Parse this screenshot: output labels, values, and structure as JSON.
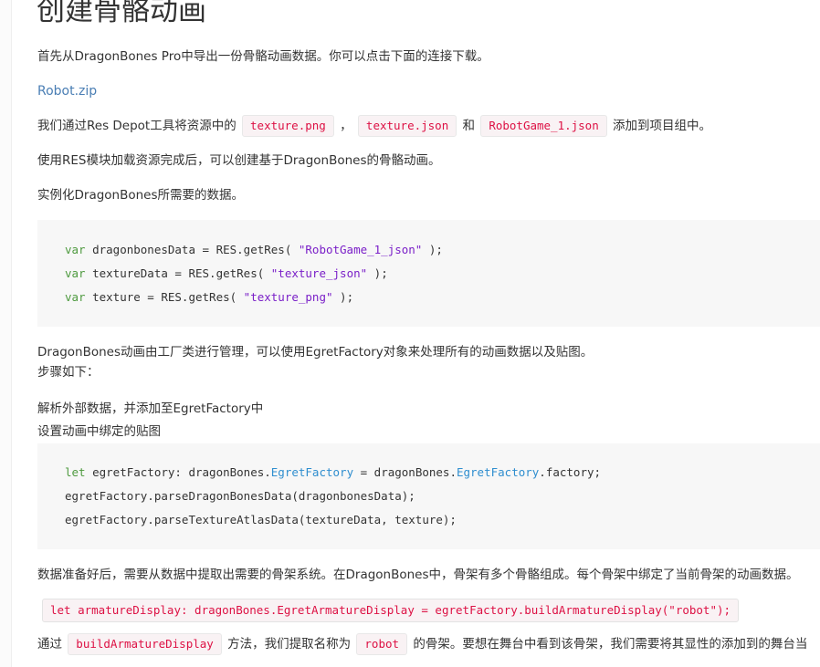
{
  "heading": "创建骨骼动画",
  "p1": "首先从DragonBones Pro中导出一份骨骼动画数据。你可以点击下面的连接下载。",
  "download_link": "Robot.zip",
  "p2": {
    "prefix": "我们通过Res Depot工具将资源中的",
    "file1": "texture.png",
    "sep1": "，",
    "file2": "texture.json",
    "and": "和",
    "file3": "RobotGame_1.json",
    "suffix": "添加到项目组中。"
  },
  "p3": "使用RES模块加载资源完成后，可以创建基于DragonBones的骨骼动画。",
  "p4": "实例化DragonBones所需要的数据。",
  "code1": [
    {
      "kw": "var",
      "pre": " dragonbonesData = RES.getRes( ",
      "str": "\"RobotGame_1_json\"",
      "post": " );"
    },
    {
      "kw": "var",
      "pre": " textureData = RES.getRes( ",
      "str": "\"texture_json\"",
      "post": " );"
    },
    {
      "kw": "var",
      "pre": " texture = RES.getRes( ",
      "str": "\"texture_png\"",
      "post": " );"
    }
  ],
  "p5_line1": "DragonBones动画由工厂类进行管理，可以使用EgretFactory对象来处理所有的动画数据以及贴图。",
  "p5_line2": "步骤如下：",
  "step1": "解析外部数据，并添加至EgretFactory中",
  "step2": "设置动画中绑定的贴图",
  "code2": {
    "line1": {
      "kw": "let",
      "a": " egretFactory: dragonBones.",
      "t1": "EgretFactory",
      "b": " = dragonBones.",
      "t2": "EgretFactory",
      "c": ".factory;"
    },
    "line2": "egretFactory.parseDragonBonesData(dragonbonesData);",
    "line3": "egretFactory.parseTextureAtlasData(textureData, texture);"
  },
  "p6": "数据准备好后，需要从数据中提取出需要的骨架系统。在DragonBones中，骨架有多个骨骼组成。每个骨架中绑定了当前骨架的动画数据。",
  "inline_code": "let armatureDisplay: dragonBones.EgretArmatureDisplay = egretFactory.buildArmatureDisplay(\"robot\");",
  "p7": {
    "prefix": "通过",
    "method": "buildArmatureDisplay",
    "mid": "方法，我们提取名称为",
    "name": "robot",
    "suffix": "的骨架。要想在舞台中看到该骨架，我们需要将其显性的添加到的舞台当"
  }
}
